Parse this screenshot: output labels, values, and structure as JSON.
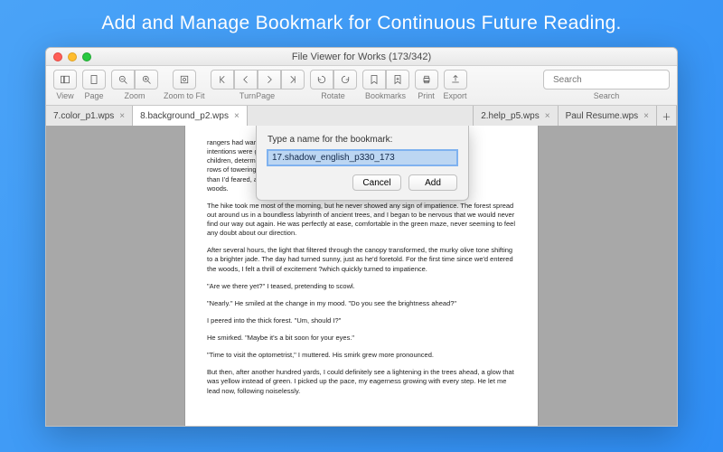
{
  "hero": "Add and Manage Bookmark for Continuous Future Reading.",
  "window": {
    "title": "File Viewer for Works (173/342)"
  },
  "toolbar": {
    "groups": {
      "view": "View",
      "page": "Page",
      "zoom": "Zoom",
      "zoom_to_fit": "Zoom to Fit",
      "turnpage": "TurnPage",
      "rotate": "Rotate",
      "bookmarks": "Bookmarks",
      "print": "Print",
      "export": "Export",
      "search_label": "Search"
    },
    "search_placeholder": "Search"
  },
  "tabs": [
    {
      "label": "7.color_p1.wps",
      "active": false,
      "closable": true
    },
    {
      "label": "8.background_p2.wps",
      "active": true,
      "closable": true
    },
    {
      "label": "",
      "active": false,
      "closable": false
    },
    {
      "label": "2.help_p5.wps",
      "active": false,
      "closable": true
    },
    {
      "label": "Paul Resume.wps",
      "active": false,
      "closable": true
    }
  ],
  "dialog": {
    "prompt": "Type a name for the bookmark:",
    "value": "17.shadow_english_p330_173",
    "cancel": "Cancel",
    "add": "Add"
  },
  "document": {
    "p0a": "rangers had warned us that the trail was steep and overgrown, my",
    "p0b": "intentions were good but my legs were weak. I kept pace with my",
    "p0c": "children, determined not to show how tired I already was. It was easier",
    "p0d": "rows of towering evergreens that seemed to multiply",
    "p0e": "than I'd feared, actually, once we reached the shade of the canopy",
    "p0f": "woods.",
    "p1": "The hike took me most of the morning, but he never showed any sign of impatience. The forest spread out around us in a boundless labyrinth of ancient trees, and I began to be nervous that we would never find our way out again. He was perfectly at ease, comfortable in the green maze, never seeming to feel any doubt about our direction.",
    "p2": "After several hours, the light that filtered through the canopy transformed, the murky olive tone shifting to a brighter jade. The day had turned sunny, just as he'd foretold. For the first time since we'd entered the woods, I felt a thrill of excitement ?which quickly turned to impatience.",
    "p3": "\"Are we there yet?\" I teased, pretending to scowl.",
    "p4": "\"Nearly.\" He smiled at the change in my mood. \"Do you see the brightness ahead?\"",
    "p5": "I peered into the thick forest. \"Um, should I?\"",
    "p6": "He smirked. \"Maybe it's a bit soon for your eyes.\"",
    "p7": "\"Time to visit the optometrist,\" I muttered. His smirk grew more pronounced.",
    "p8": "But then, after another hundred yards, I could definitely see a lightening in the trees ahead, a glow that was yellow instead of green. I picked up the pace, my eagerness growing with every step. He let me lead now, following noiselessly."
  }
}
